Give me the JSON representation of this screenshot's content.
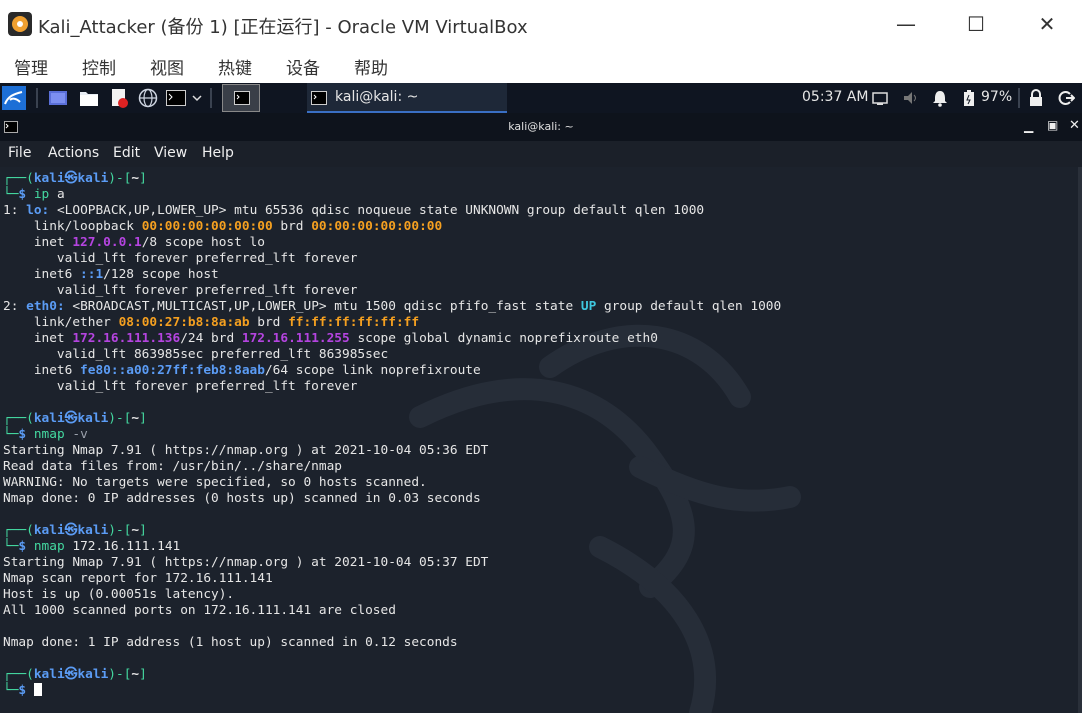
{
  "window": {
    "title": "Kali_Attacker (备份 1) [正在运行] - Oracle VM VirtualBox",
    "minimize": "—",
    "maximize": "☐",
    "close": "✕"
  },
  "vb_menu": [
    "管理",
    "控制",
    "视图",
    "热键",
    "设备",
    "帮助"
  ],
  "panel": {
    "clock": "05:37 AM",
    "battery": "97%",
    "task_label": "kali@kali: ~",
    "icons": [
      "kali-menu-icon",
      "workspace-icon",
      "file-manager-icon",
      "text-editor-icon",
      "browser-icon",
      "terminal-icon",
      "volume-icon",
      "notification-bell-icon",
      "battery-icon",
      "lock-icon",
      "logout-icon"
    ]
  },
  "terminal": {
    "title": "kali@kali: ~",
    "menu": [
      "File",
      "Actions",
      "Edit",
      "View",
      "Help"
    ],
    "commands": [
      {
        "prompt_user": "kali",
        "prompt_host": "kali",
        "prompt_dir": "~",
        "cmd": "ip",
        "args": " a",
        "output": [
          [
            [
              "1: ",
              ""
            ],
            [
              "lo:",
              "blue bold"
            ],
            [
              " <LOOPBACK,UP,LOWER_UP> mtu 65536 qdisc noqueue state UNKNOWN group default qlen 1000",
              ""
            ]
          ],
          [
            [
              "    link/loopback ",
              ""
            ],
            [
              "00:00:00:00:00:00",
              "orange bold"
            ],
            [
              " brd ",
              ""
            ],
            [
              "00:00:00:00:00:00",
              "orange bold"
            ]
          ],
          [
            [
              "    inet ",
              ""
            ],
            [
              "127.0.0.1",
              "purple bold"
            ],
            [
              "/8 scope host lo",
              ""
            ]
          ],
          [
            [
              "       valid_lft forever preferred_lft forever",
              ""
            ]
          ],
          [
            [
              "    inet6 ",
              ""
            ],
            [
              "::1",
              "blue bold"
            ],
            [
              "/128 scope host",
              ""
            ]
          ],
          [
            [
              "       valid_lft forever preferred_lft forever",
              ""
            ]
          ],
          [
            [
              "2: ",
              ""
            ],
            [
              "eth0:",
              "blue bold"
            ],
            [
              " <BROADCAST,MULTICAST,UP,LOWER_UP> mtu 1500 qdisc pfifo_fast state ",
              ""
            ],
            [
              "UP",
              "green bold"
            ],
            [
              " group default qlen 1000",
              ""
            ]
          ],
          [
            [
              "    link/ether ",
              ""
            ],
            [
              "08:00:27:b8:8a:ab",
              "orange bold"
            ],
            [
              " brd ",
              ""
            ],
            [
              "ff:ff:ff:ff:ff:ff",
              "orange bold"
            ]
          ],
          [
            [
              "    inet ",
              ""
            ],
            [
              "172.16.111.136",
              "purple bold"
            ],
            [
              "/24 brd ",
              ""
            ],
            [
              "172.16.111.255",
              "purple bold"
            ],
            [
              " scope global dynamic noprefixroute eth0",
              ""
            ]
          ],
          [
            [
              "       valid_lft 863985sec preferred_lft 863985sec",
              ""
            ]
          ],
          [
            [
              "    inet6 ",
              ""
            ],
            [
              "fe80::a00:27ff:feb8:8aab",
              "blue bold"
            ],
            [
              "/64 scope link noprefixroute",
              ""
            ]
          ],
          [
            [
              "       valid_lft forever preferred_lft forever",
              ""
            ]
          ],
          [
            [
              "",
              ""
            ]
          ]
        ]
      },
      {
        "prompt_user": "kali",
        "prompt_host": "kali",
        "prompt_dir": "~",
        "cmd": "nmap",
        "args": " -v",
        "output": [
          [
            [
              "Starting Nmap 7.91 ( https://nmap.org ) at 2021-10-04 05:36 EDT",
              ""
            ]
          ],
          [
            [
              "Read data files from: /usr/bin/../share/nmap",
              ""
            ]
          ],
          [
            [
              "WARNING: No targets were specified, so 0 hosts scanned.",
              ""
            ]
          ],
          [
            [
              "Nmap done: 0 IP addresses (0 hosts up) scanned in 0.03 seconds",
              ""
            ]
          ],
          [
            [
              "",
              ""
            ]
          ]
        ]
      },
      {
        "prompt_user": "kali",
        "prompt_host": "kali",
        "prompt_dir": "~",
        "cmd": "nmap",
        "args": " 172.16.111.141",
        "output": [
          [
            [
              "Starting Nmap 7.91 ( https://nmap.org ) at 2021-10-04 05:37 EDT",
              ""
            ]
          ],
          [
            [
              "Nmap scan report for 172.16.111.141",
              ""
            ]
          ],
          [
            [
              "Host is up (0.00051s latency).",
              ""
            ]
          ],
          [
            [
              "All 1000 scanned ports on 172.16.111.141 are closed",
              ""
            ]
          ],
          [
            [
              "",
              ""
            ]
          ],
          [
            [
              "Nmap done: 1 IP address (1 host up) scanned in 0.12 seconds",
              ""
            ]
          ],
          [
            [
              "",
              ""
            ]
          ]
        ]
      },
      {
        "prompt_user": "kali",
        "prompt_host": "kali",
        "prompt_dir": "~",
        "cmd": "",
        "args": "",
        "output": []
      }
    ]
  }
}
